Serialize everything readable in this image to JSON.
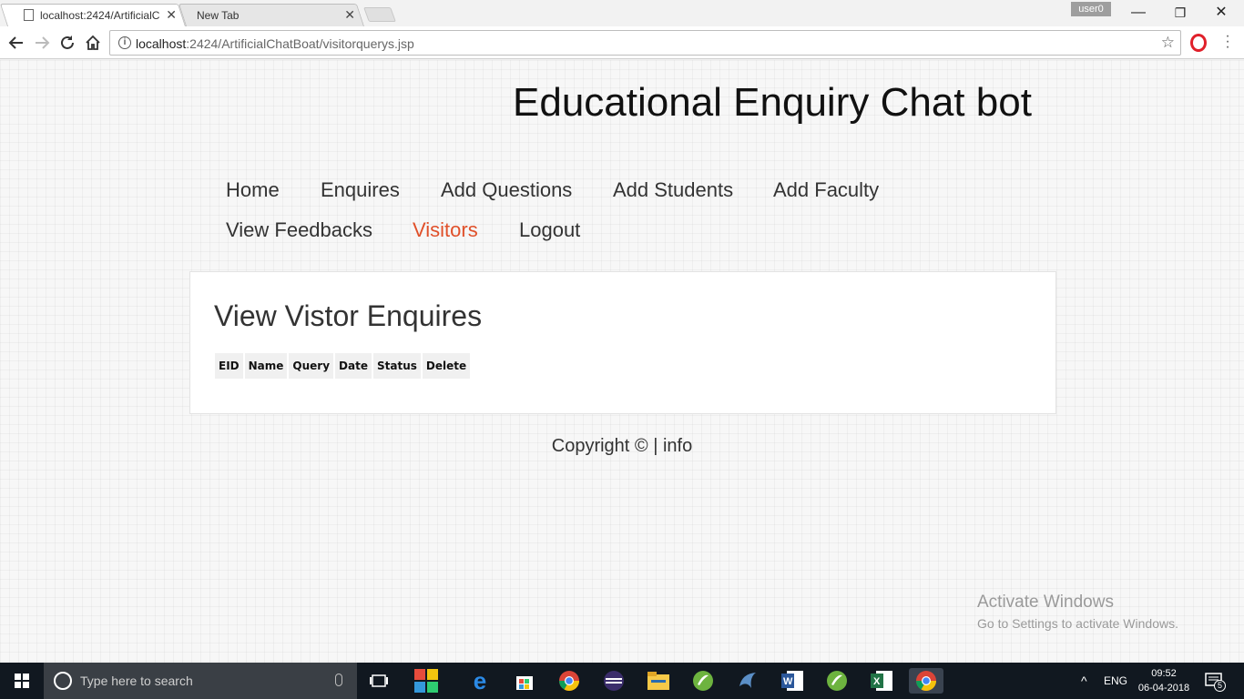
{
  "browser": {
    "tabs": [
      {
        "title": "localhost:2424/ArtificialC",
        "active": true
      },
      {
        "title": "New Tab",
        "active": false
      }
    ],
    "user_badge": "user0",
    "url_host": "localhost",
    "url_path": ":2424/ArtificialChatBoat/visitorquerys.jsp"
  },
  "site": {
    "title": "Educational Enquiry Chat bot",
    "menu_row1": [
      "Home",
      "Enquires",
      "Add Questions",
      "Add Students",
      "Add Faculty"
    ],
    "menu_row2": [
      "View Feedbacks",
      "Visitors",
      "Logout"
    ],
    "current_menu": "Visitors",
    "accent_color": "#e0502a"
  },
  "panel": {
    "heading": "View Vistor Enquires",
    "columns": [
      "EID",
      "Name",
      "Query",
      "Date",
      "Status",
      "Delete"
    ]
  },
  "footer": {
    "copyright": "Copyright © | ",
    "info_link": "info"
  },
  "watermark": {
    "line1": "Activate Windows",
    "line2": "Go to Settings to activate Windows."
  },
  "taskbar": {
    "search_placeholder": "Type here to search",
    "language": "ENG",
    "time": "09:52",
    "date": "06-04-2018",
    "notification_count": "5"
  }
}
